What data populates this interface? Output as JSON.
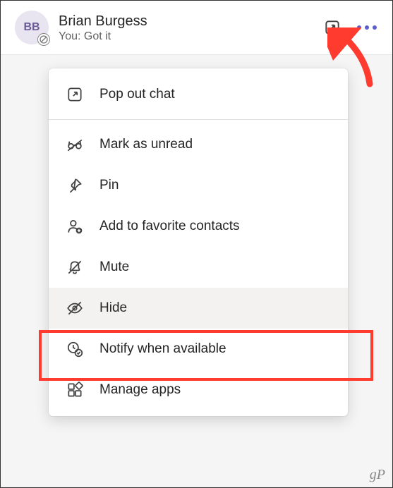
{
  "chat": {
    "initials": "BB",
    "name": "Brian Burgess",
    "preview": "You: Got it"
  },
  "menu": {
    "pop_out": "Pop out chat",
    "mark_unread": "Mark as unread",
    "pin": "Pin",
    "add_favorite": "Add to favorite contacts",
    "mute": "Mute",
    "hide": "Hide",
    "notify": "Notify when available",
    "manage_apps": "Manage apps"
  },
  "watermark": "gP"
}
